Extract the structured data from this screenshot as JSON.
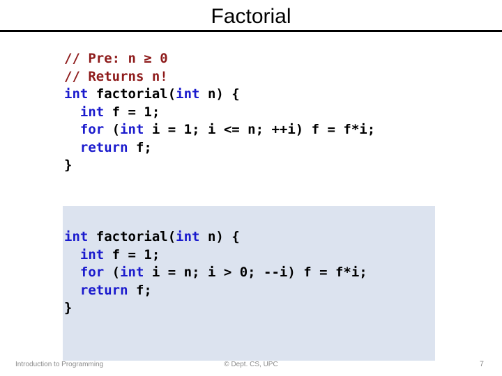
{
  "slide": {
    "title": "Factorial",
    "page_number": "7"
  },
  "colors": {
    "comment": "#8e1b1b",
    "keyword": "#1a1acd",
    "plain": "#000000",
    "highlight_background": "#dce3ef",
    "title_rule": "#000000",
    "footer_text": "#8a8a8a"
  },
  "code_blocks": [
    {
      "id": "iterative-ascending",
      "highlighted": false,
      "lines": [
        [
          {
            "text": "// Pre: n ≥ 0",
            "kind": "comment"
          }
        ],
        [
          {
            "text": "// Returns n!",
            "kind": "comment"
          }
        ],
        [
          {
            "text": "int",
            "kind": "keyword"
          },
          {
            "text": " factorial(",
            "kind": "plain"
          },
          {
            "text": "int",
            "kind": "keyword"
          },
          {
            "text": " n) {",
            "kind": "plain"
          }
        ],
        [
          {
            "text": "  ",
            "kind": "plain"
          },
          {
            "text": "int",
            "kind": "keyword"
          },
          {
            "text": " f = 1;",
            "kind": "plain"
          }
        ],
        [
          {
            "text": "  ",
            "kind": "plain"
          },
          {
            "text": "for",
            "kind": "keyword"
          },
          {
            "text": " (",
            "kind": "plain"
          },
          {
            "text": "int",
            "kind": "keyword"
          },
          {
            "text": " i = 1; i <= n; ++i) f = f*i;",
            "kind": "plain"
          }
        ],
        [
          {
            "text": "  ",
            "kind": "plain"
          },
          {
            "text": "return",
            "kind": "keyword"
          },
          {
            "text": " f;",
            "kind": "plain"
          }
        ],
        [
          {
            "text": "}",
            "kind": "plain"
          }
        ]
      ]
    },
    {
      "id": "iterative-descending",
      "highlighted": true,
      "lines": [
        [
          {
            "text": "int",
            "kind": "keyword"
          },
          {
            "text": " factorial(",
            "kind": "plain"
          },
          {
            "text": "int",
            "kind": "keyword"
          },
          {
            "text": " n) {",
            "kind": "plain"
          }
        ],
        [
          {
            "text": "  ",
            "kind": "plain"
          },
          {
            "text": "int",
            "kind": "keyword"
          },
          {
            "text": " f = 1;",
            "kind": "plain"
          }
        ],
        [
          {
            "text": "  ",
            "kind": "plain"
          },
          {
            "text": "for",
            "kind": "keyword"
          },
          {
            "text": " (",
            "kind": "plain"
          },
          {
            "text": "int",
            "kind": "keyword"
          },
          {
            "text": " i = n; i > 0; --i) f = f*i;",
            "kind": "plain"
          }
        ],
        [
          {
            "text": "  ",
            "kind": "plain"
          },
          {
            "text": "return",
            "kind": "keyword"
          },
          {
            "text": " f;",
            "kind": "plain"
          }
        ],
        [
          {
            "text": "}",
            "kind": "plain"
          }
        ]
      ]
    }
  ],
  "footer": {
    "left": "Introduction to Programming",
    "center": "© Dept. CS, UPC"
  }
}
